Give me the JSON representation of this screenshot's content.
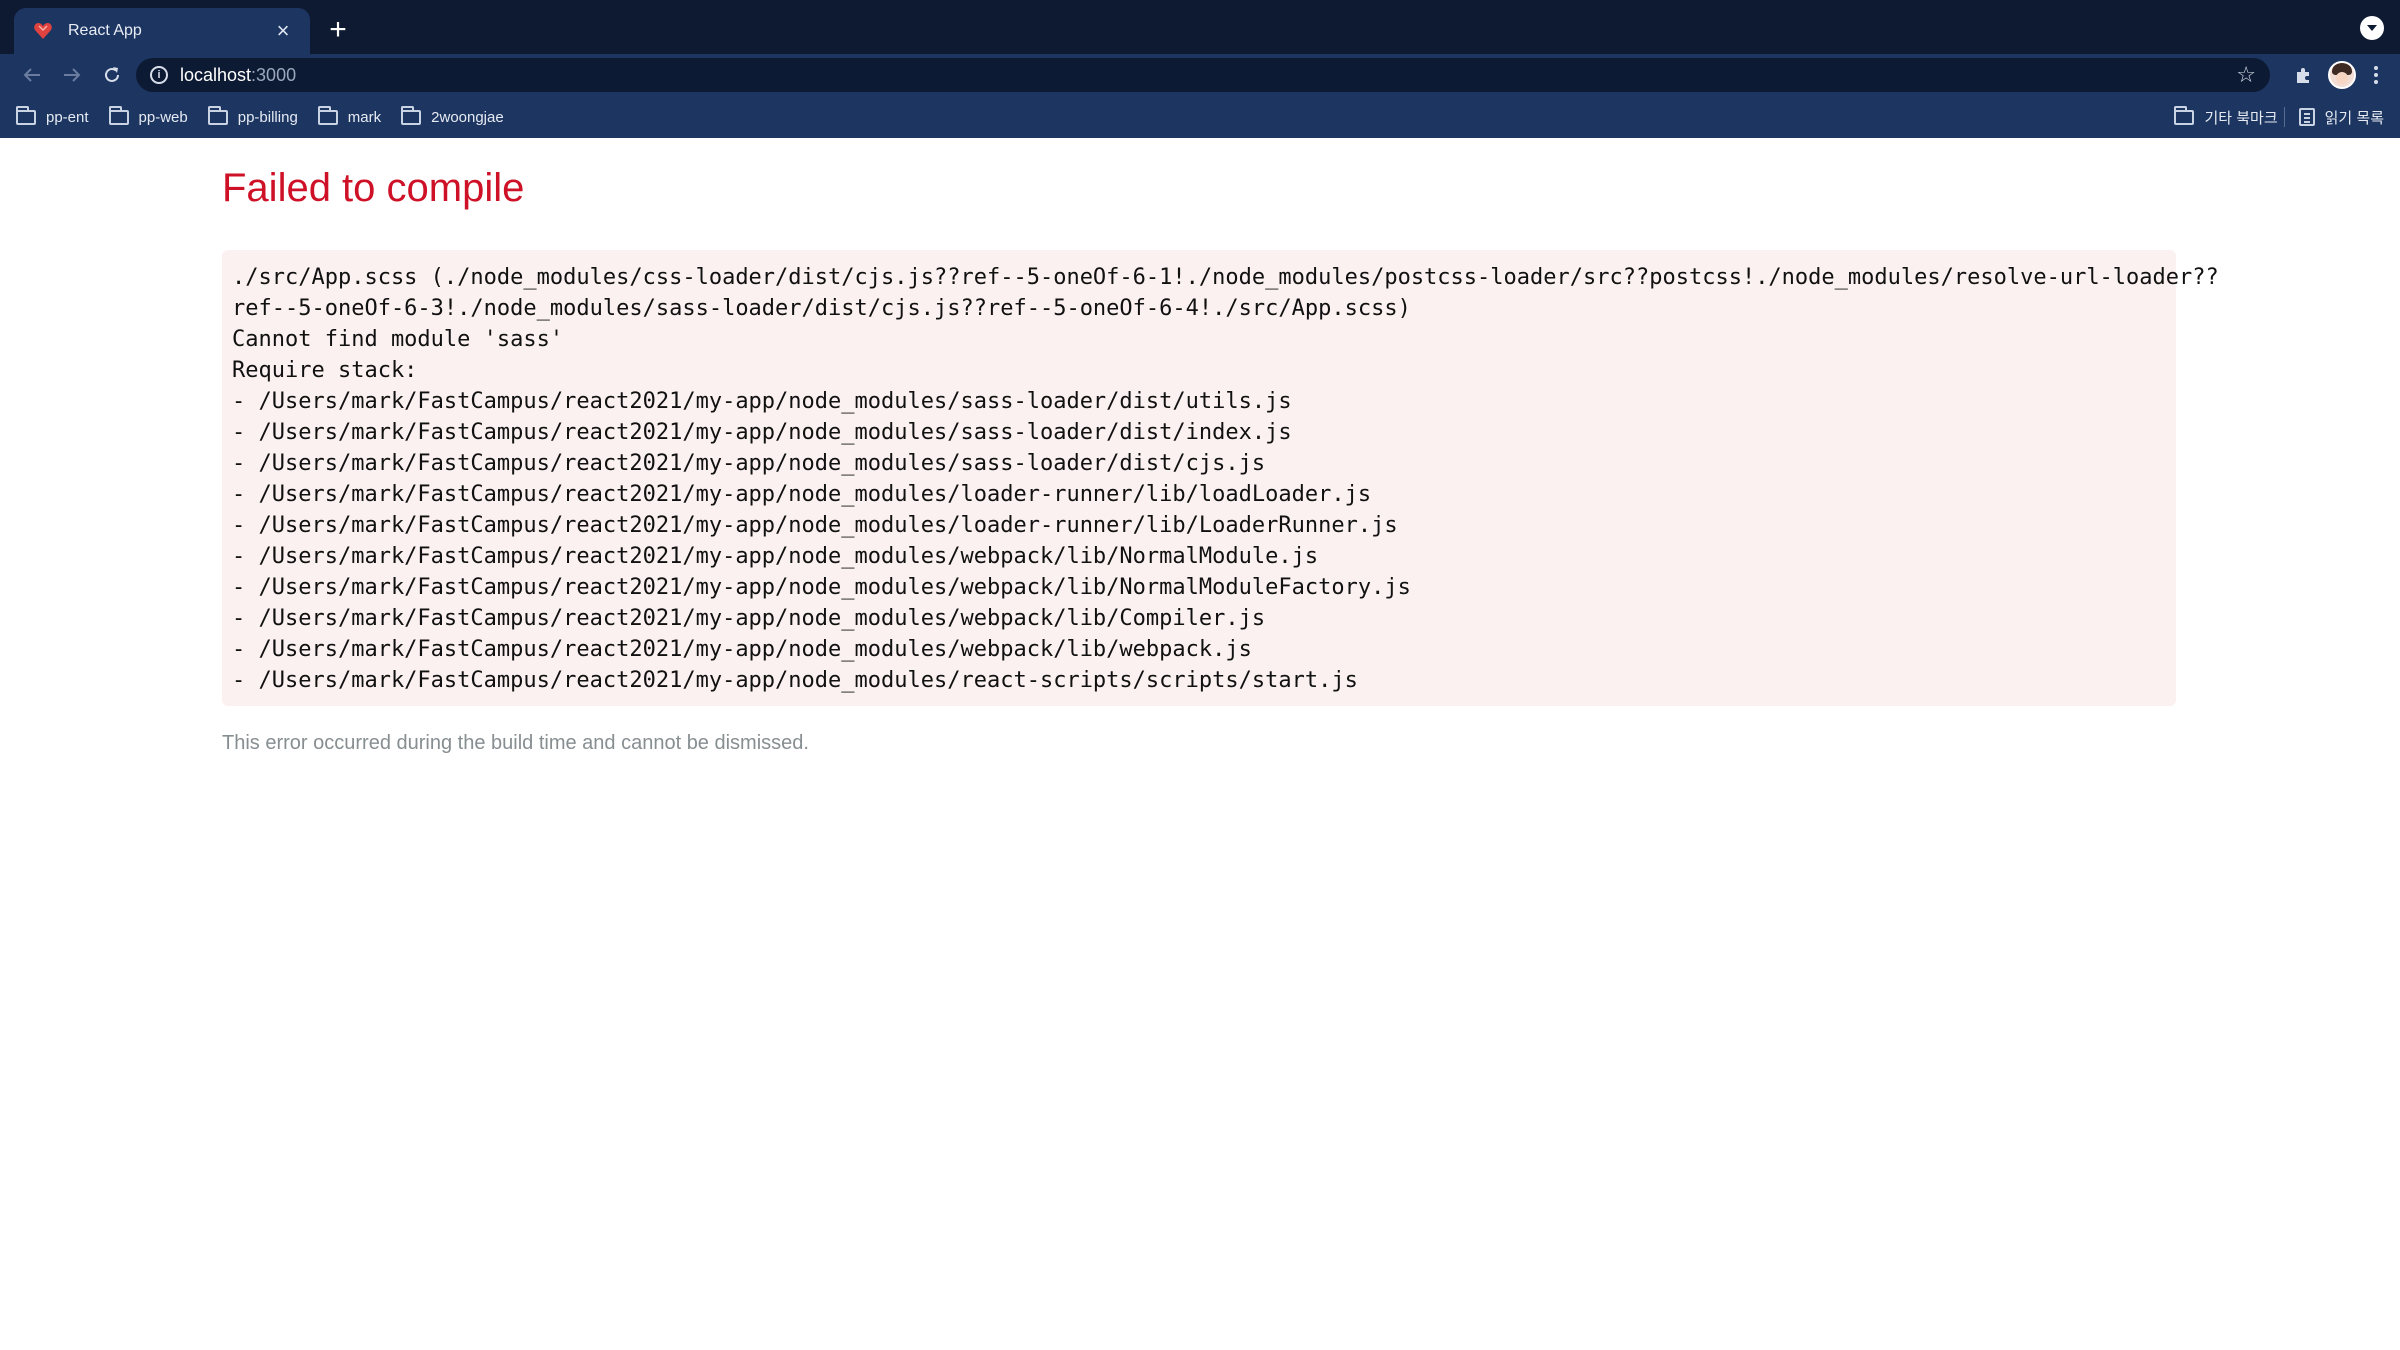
{
  "browser": {
    "tab": {
      "title": "React App",
      "favicon": "react-heart-favicon",
      "close_glyph": "×"
    },
    "new_tab_glyph": "+",
    "address": {
      "host": "localhost",
      "port": ":3000"
    },
    "bookmarks": [
      {
        "label": "pp-ent"
      },
      {
        "label": "pp-web"
      },
      {
        "label": "pp-billing"
      },
      {
        "label": "mark"
      },
      {
        "label": "2woongjae"
      }
    ],
    "bookmarks_right": {
      "other": "기타 북마크",
      "reading_list": "읽기 목록"
    }
  },
  "page": {
    "title": "Failed to compile",
    "error_lines": [
      "./src/App.scss (./node_modules/css-loader/dist/cjs.js??ref--5-oneOf-6-1!./node_modules/postcss-loader/src??postcss!./node_modules/resolve-url-loader??",
      "ref--5-oneOf-6-3!./node_modules/sass-loader/dist/cjs.js??ref--5-oneOf-6-4!./src/App.scss)",
      "Cannot find module 'sass'",
      "Require stack:",
      "- /Users/mark/FastCampus/react2021/my-app/node_modules/sass-loader/dist/utils.js",
      "- /Users/mark/FastCampus/react2021/my-app/node_modules/sass-loader/dist/index.js",
      "- /Users/mark/FastCampus/react2021/my-app/node_modules/sass-loader/dist/cjs.js",
      "- /Users/mark/FastCampus/react2021/my-app/node_modules/loader-runner/lib/loadLoader.js",
      "- /Users/mark/FastCampus/react2021/my-app/node_modules/loader-runner/lib/LoaderRunner.js",
      "- /Users/mark/FastCampus/react2021/my-app/node_modules/webpack/lib/NormalModule.js",
      "- /Users/mark/FastCampus/react2021/my-app/node_modules/webpack/lib/NormalModuleFactory.js",
      "- /Users/mark/FastCampus/react2021/my-app/node_modules/webpack/lib/Compiler.js",
      "- /Users/mark/FastCampus/react2021/my-app/node_modules/webpack/lib/webpack.js",
      "- /Users/mark/FastCampus/react2021/my-app/node_modules/react-scripts/scripts/start.js"
    ],
    "footer": "This error occurred during the build time and cannot be dismissed."
  },
  "colors": {
    "title_red": "#ce1126",
    "error_box_bg": "#fcf1f1",
    "chrome_dark": "#0e1a32",
    "chrome_toolbar": "#1d3561",
    "footer_gray": "#878e91"
  }
}
